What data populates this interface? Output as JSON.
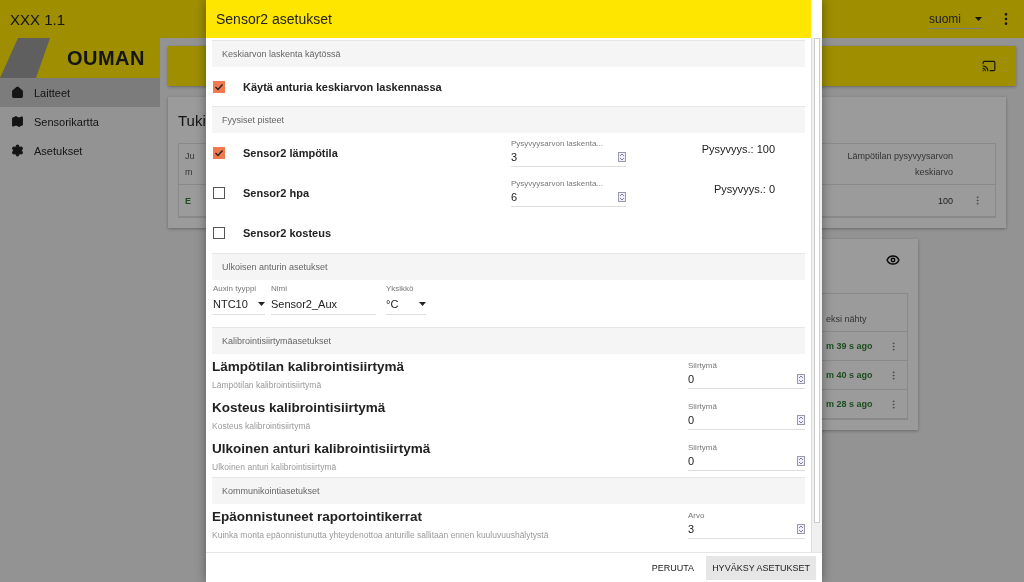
{
  "app": {
    "title": "XXX 1.1",
    "language": "suomi",
    "logo": "OUMAN",
    "nav": [
      {
        "label": "Laitteet",
        "selected": true
      },
      {
        "label": "Sensorikartta",
        "selected": false
      },
      {
        "label": "Asetukset",
        "selected": false
      }
    ]
  },
  "background": {
    "card_title": "Tuki",
    "table": {
      "column_1": [
        "Ju",
        "m"
      ],
      "column_2": "Lämpötilan pysyvyysarvon keskiarvo",
      "rows": [
        {
          "column_1": "E",
          "column_2": "100"
        }
      ]
    },
    "devices": {
      "column_header": "eksi nähty",
      "rows": [
        "m 39 s ago",
        "m 40 s ago",
        "m 28 s ago"
      ]
    }
  },
  "dialog": {
    "title": "Sensor2 asetukset",
    "sections": [
      {
        "kind": "checks",
        "header": "Keskiarvon laskenta käytössä",
        "items": [
          {
            "label": "Käytä anturia keskiarvon laskennassa",
            "checked": true
          }
        ]
      },
      {
        "kind": "checks",
        "header": "Fyysiset pisteet",
        "items": [
          {
            "label": "Sensor2 lämpötila",
            "checked": true,
            "field_label": "Pysyvyysarvon laskenta...",
            "value": "3",
            "stability": "Pysyvyys.: 100"
          },
          {
            "label": "Sensor2 hpa",
            "checked": false,
            "field_label": "Pysyvyysarvon laskenta...",
            "value": "6",
            "stability": "Pysyvyys.: 0"
          },
          {
            "label": "Sensor2 kosteus",
            "checked": false
          }
        ]
      },
      {
        "kind": "aux",
        "header": "Ulkoisen anturin asetukset",
        "fields": [
          {
            "kind": "select",
            "label": "Auxin tyyppi",
            "value": "NTC10"
          },
          {
            "kind": "text",
            "label": "Nimi",
            "value": "Sensor2_Aux"
          },
          {
            "kind": "select",
            "label": "Yksikkö",
            "value": "°C"
          }
        ]
      },
      {
        "kind": "numbers",
        "header": "Kalibrointisiirtymäasetukset",
        "items": [
          {
            "title": "Lämpötilan kalibrointisiirtymä",
            "subtitle": "Lämpötilan kalibrointisiirtymä",
            "field_label": "Siirtymä",
            "value": "0"
          },
          {
            "title": "Kosteus kalibrointisiirtymä",
            "subtitle": "Kosteus kalibrointisiirtymä",
            "field_label": "Siirtymä",
            "value": "0"
          },
          {
            "title": "Ulkoinen anturi kalibrointisiirtymä",
            "subtitle": "Ulkoinen anturi kalibrointisiirtymä",
            "field_label": "Siirtymä",
            "value": "0"
          }
        ]
      },
      {
        "kind": "numbers",
        "header": "Kommunikointiasetukset",
        "items": [
          {
            "title": "Epäonnistuneet raportointikerrat",
            "subtitle": "Kuinka monta epäonnistunutta yhteydenottoa anturille sallitaan ennen kuuluvuushälytystä",
            "field_label": "Arvo",
            "value": "3"
          }
        ]
      }
    ],
    "buttons": [
      {
        "label": "PERUUTA",
        "kind": "flat"
      },
      {
        "label": "HYVÄKSY ASETUKSET",
        "kind": "raised"
      }
    ]
  }
}
